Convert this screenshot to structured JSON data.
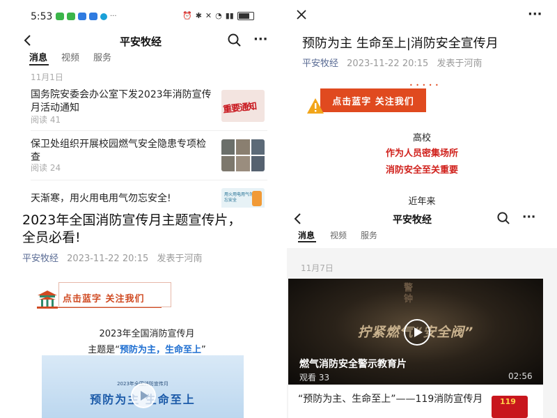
{
  "status_bar": {
    "time": "5:53"
  },
  "channel": {
    "name": "平安牧经"
  },
  "tabs": [
    "消息",
    "视频",
    "服务"
  ],
  "left_feed": {
    "date": "11月1日",
    "articles": [
      {
        "title": "国务院安委会办公室下发2023年消防宣传月活动通知",
        "reads": "阅读 41",
        "thumb_text": "重要通知"
      },
      {
        "title": "保卫处组织开展校园燃气安全隐患专项检查",
        "reads": "阅读 24"
      },
      {
        "title": "天渐寒，用火用电用气勿忘安全!",
        "thumb_text": "用火用电用气勿忘安全"
      }
    ]
  },
  "left_article": {
    "title": "2023年全国消防宣传月主题宣传片，全员必看!",
    "account": "平安牧经",
    "date": "2023-11-22 20:15",
    "location": "发表于河南",
    "banner": "点击蓝字 关注我们",
    "body_line1": "2023年全国消防宣传月",
    "theme_prefix": "主题是“",
    "theme_highlight": "预防为主，生命至上",
    "theme_suffix": "”",
    "video_subtitle": "2023年全国消防宣传月",
    "video_title": "预防为主 生命至上"
  },
  "right_article": {
    "title": "预防为主 生命至上|消防安全宣传月",
    "account": "平安牧经",
    "date": "2023-11-22 20:15",
    "location": "发表于河南",
    "banner": "点击蓝字 关注我们",
    "line1": "高校",
    "line2": "作为人员密集场所",
    "line3": "消防安全至关重要",
    "line4": "近年来"
  },
  "right_feed": {
    "date": "11月7日",
    "video": {
      "overlay_top": "警钟",
      "overlay_main": "拧紧燃气“安全阀”",
      "title": "燃气消防安全警示教育片",
      "views": "观看 33",
      "duration": "02:56"
    },
    "next_article": {
      "title": "“预防为主、生命至上”——119消防宣传月",
      "thumb_text": "119"
    }
  },
  "colors": {
    "accent_orange": "#e04a1f",
    "link_blue": "#586a93",
    "highlight_red": "#d0201b",
    "theme_blue": "#1f6fd1"
  }
}
